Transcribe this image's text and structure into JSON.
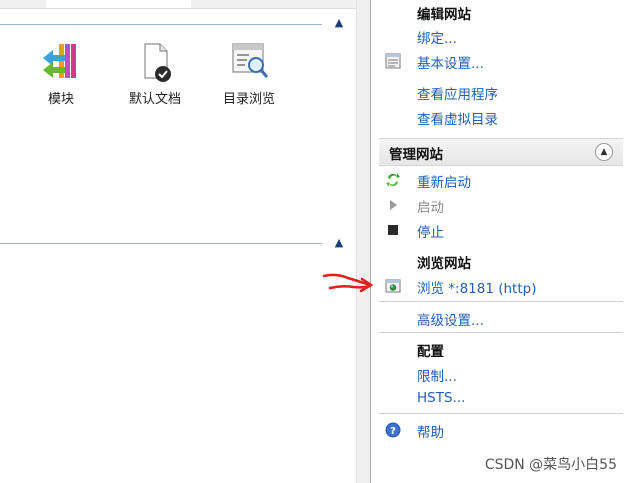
{
  "features": [
    {
      "label": "模块",
      "icon": "modules-icon"
    },
    {
      "label": "默认文档",
      "icon": "default-document-icon"
    },
    {
      "label": "目录浏览",
      "icon": "directory-browsing-icon"
    }
  ],
  "actions": {
    "edit_site": {
      "heading": "编辑网站",
      "bindings": "绑定...",
      "basic_settings": "基本设置...",
      "view_applications": "查看应用程序",
      "view_virtual_dirs": "查看虚拟目录"
    },
    "manage_site": {
      "heading": "管理网站",
      "restart": "重新启动",
      "start": "启动",
      "stop": "停止"
    },
    "browse_site": {
      "heading": "浏览网站",
      "browse": "浏览 *:8181 (http)"
    },
    "advanced_settings": "高级设置...",
    "configure": {
      "heading": "配置",
      "limits": "限制...",
      "hsts": "HSTS..."
    },
    "help": "帮助"
  },
  "watermark": "CSDN @菜鸟小白55",
  "colors": {
    "link": "#2260b4",
    "annotation_arrow": "#e0201b",
    "disabled": "#8a8a8a"
  }
}
